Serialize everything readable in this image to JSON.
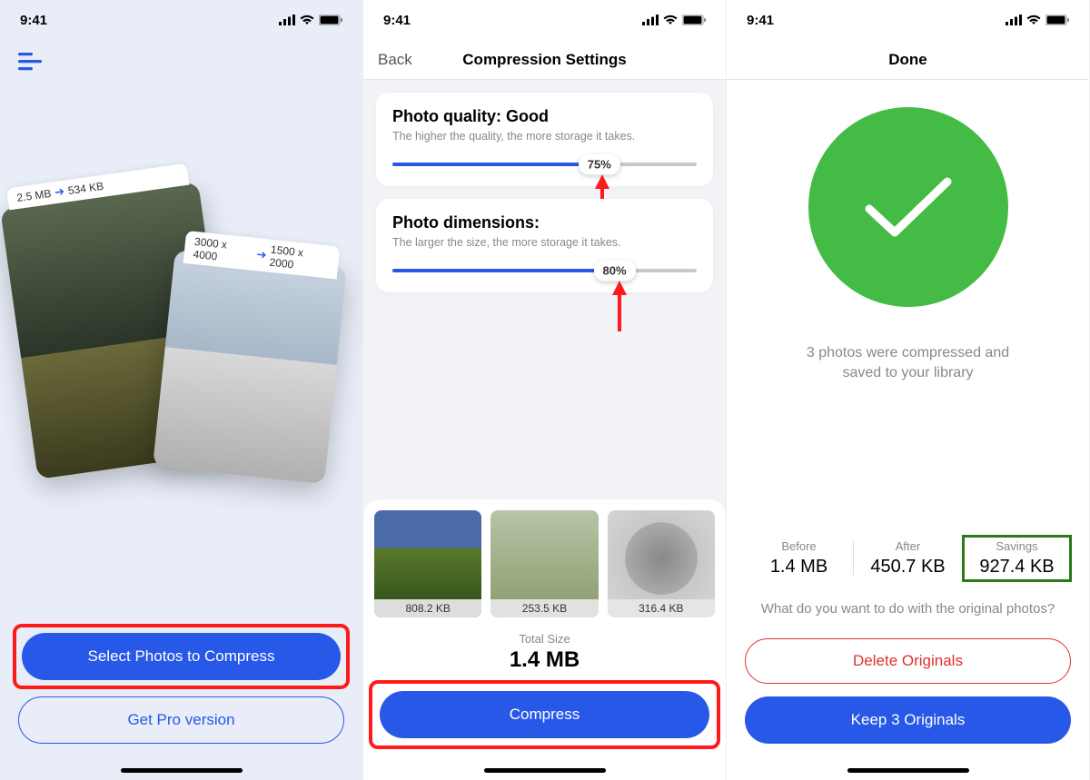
{
  "status_time": "9:41",
  "screen1": {
    "card1_before": "2.5 MB",
    "card1_after": "534 KB",
    "card2_before": "3000 x 4000",
    "card2_after": "1500 x 2000",
    "select_button": "Select Photos to Compress",
    "pro_button": "Get Pro version"
  },
  "screen2": {
    "back": "Back",
    "title": "Compression Settings",
    "quality_title": "Photo quality: Good",
    "quality_sub": "The higher the quality, the more storage it takes.",
    "quality_pct": "75%",
    "quality_fill": 68,
    "dim_title": "Photo dimensions:",
    "dim_sub": "The larger the size, the more storage it takes.",
    "dim_pct": "80%",
    "dim_fill": 73,
    "thumbs": [
      "808.2 KB",
      "253.5 KB",
      "316.4 KB"
    ],
    "total_label": "Total Size",
    "total_value": "1.4 MB",
    "compress_button": "Compress"
  },
  "screen3": {
    "title": "Done",
    "msg": "3 photos were compressed and saved to your library",
    "before_label": "Before",
    "before_value": "1.4 MB",
    "after_label": "After",
    "after_value": "450.7 KB",
    "savings_label": "Savings",
    "savings_value": "927.4 KB",
    "originals_q": "What do you want to do with the original photos?",
    "delete_button": "Delete Originals",
    "keep_button": "Keep 3 Originals"
  }
}
